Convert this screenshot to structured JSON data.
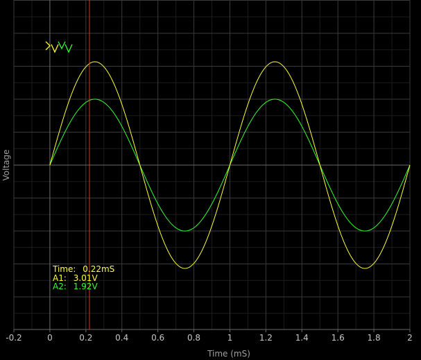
{
  "chart_data": {
    "type": "line",
    "title": "",
    "xlabel": "Time (mS)",
    "ylabel": "Voltage",
    "xlim": [
      -0.2,
      2.0
    ],
    "x_ticks": [
      "-0.2",
      "0",
      "0.2",
      "0.4",
      "0.6",
      "0.8",
      "1",
      "1.2",
      "1.4",
      "1.6",
      "1.8",
      "2"
    ],
    "grid": true,
    "series": [
      {
        "key": "A1",
        "color": "#ffff33",
        "amplitude_v": 3.01,
        "frequency_khz": 1.0,
        "x": [
          0,
          0.25,
          0.5,
          0.75,
          1.0,
          1.25,
          1.5,
          1.75,
          2.0
        ],
        "y": [
          0,
          3.01,
          0,
          -3.01,
          0,
          3.01,
          0,
          -3.01,
          0
        ]
      },
      {
        "key": "A2",
        "color": "#33ff33",
        "amplitude_v": 1.92,
        "frequency_khz": 1.0,
        "x": [
          0,
          0.25,
          0.5,
          0.75,
          1.0,
          1.25,
          1.5,
          1.75,
          2.0
        ],
        "y": [
          0,
          1.92,
          0,
          -1.92,
          0,
          1.92,
          0,
          -1.92,
          0
        ]
      }
    ],
    "cursor": {
      "x": 0.22,
      "color": "#e03030"
    },
    "readout": {
      "time_label": "Time:",
      "time_value": "0.22mS",
      "a1_label": "A1:",
      "a1_value": "3.01V",
      "a2_label": "A2:",
      "a2_value": "1.92V"
    }
  },
  "colors": {
    "background": "#000000",
    "grid_major": "#3a3a3a",
    "grid_minor": "#1c1c1c",
    "axis": "#6a6a6a"
  }
}
